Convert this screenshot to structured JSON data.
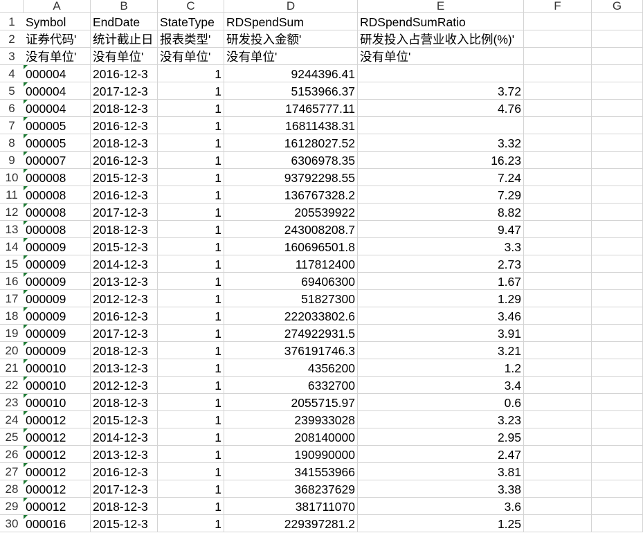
{
  "columns": [
    "A",
    "B",
    "C",
    "D",
    "E",
    "F",
    "G"
  ],
  "rows": [
    {
      "n": "1",
      "cells": [
        "Symbol",
        "EndDate",
        "StateType",
        "RDSpendSum",
        "RDSpendSumRatio",
        "",
        ""
      ]
    },
    {
      "n": "2",
      "cells": [
        "证券代码'",
        "统计截止日",
        "报表类型'",
        "研发投入金额'",
        "研发投入占营业收入比例(%)'",
        "",
        ""
      ]
    },
    {
      "n": "3",
      "cells": [
        "没有单位'",
        "没有单位'",
        "没有单位'",
        "没有单位'",
        "没有单位'",
        "",
        ""
      ]
    },
    {
      "n": "4",
      "cells": [
        "000004",
        "2016-12-3",
        "1",
        "9244396.41",
        "",
        "",
        ""
      ]
    },
    {
      "n": "5",
      "cells": [
        "000004",
        "2017-12-3",
        "1",
        "5153966.37",
        "3.72",
        "",
        ""
      ]
    },
    {
      "n": "6",
      "cells": [
        "000004",
        "2018-12-3",
        "1",
        "17465777.11",
        "4.76",
        "",
        ""
      ]
    },
    {
      "n": "7",
      "cells": [
        "000005",
        "2016-12-3",
        "1",
        "16811438.31",
        "",
        "",
        ""
      ]
    },
    {
      "n": "8",
      "cells": [
        "000005",
        "2018-12-3",
        "1",
        "16128027.52",
        "3.32",
        "",
        ""
      ]
    },
    {
      "n": "9",
      "cells": [
        "000007",
        "2016-12-3",
        "1",
        "6306978.35",
        "16.23",
        "",
        ""
      ]
    },
    {
      "n": "10",
      "cells": [
        "000008",
        "2015-12-3",
        "1",
        "93792298.55",
        "7.24",
        "",
        ""
      ]
    },
    {
      "n": "11",
      "cells": [
        "000008",
        "2016-12-3",
        "1",
        "136767328.2",
        "7.29",
        "",
        ""
      ]
    },
    {
      "n": "12",
      "cells": [
        "000008",
        "2017-12-3",
        "1",
        "205539922",
        "8.82",
        "",
        ""
      ]
    },
    {
      "n": "13",
      "cells": [
        "000008",
        "2018-12-3",
        "1",
        "243008208.7",
        "9.47",
        "",
        ""
      ]
    },
    {
      "n": "14",
      "cells": [
        "000009",
        "2015-12-3",
        "1",
        "160696501.8",
        "3.3",
        "",
        ""
      ]
    },
    {
      "n": "15",
      "cells": [
        "000009",
        "2014-12-3",
        "1",
        "117812400",
        "2.73",
        "",
        ""
      ]
    },
    {
      "n": "16",
      "cells": [
        "000009",
        "2013-12-3",
        "1",
        "69406300",
        "1.67",
        "",
        ""
      ]
    },
    {
      "n": "17",
      "cells": [
        "000009",
        "2012-12-3",
        "1",
        "51827300",
        "1.29",
        "",
        ""
      ]
    },
    {
      "n": "18",
      "cells": [
        "000009",
        "2016-12-3",
        "1",
        "222033802.6",
        "3.46",
        "",
        ""
      ]
    },
    {
      "n": "19",
      "cells": [
        "000009",
        "2017-12-3",
        "1",
        "274922931.5",
        "3.91",
        "",
        ""
      ]
    },
    {
      "n": "20",
      "cells": [
        "000009",
        "2018-12-3",
        "1",
        "376191746.3",
        "3.21",
        "",
        ""
      ]
    },
    {
      "n": "21",
      "cells": [
        "000010",
        "2013-12-3",
        "1",
        "4356200",
        "1.2",
        "",
        ""
      ]
    },
    {
      "n": "22",
      "cells": [
        "000010",
        "2012-12-3",
        "1",
        "6332700",
        "3.4",
        "",
        ""
      ]
    },
    {
      "n": "23",
      "cells": [
        "000010",
        "2018-12-3",
        "1",
        "2055715.97",
        "0.6",
        "",
        ""
      ]
    },
    {
      "n": "24",
      "cells": [
        "000012",
        "2015-12-3",
        "1",
        "239933028",
        "3.23",
        "",
        ""
      ]
    },
    {
      "n": "25",
      "cells": [
        "000012",
        "2014-12-3",
        "1",
        "208140000",
        "2.95",
        "",
        ""
      ]
    },
    {
      "n": "26",
      "cells": [
        "000012",
        "2013-12-3",
        "1",
        "190990000",
        "2.47",
        "",
        ""
      ]
    },
    {
      "n": "27",
      "cells": [
        "000012",
        "2016-12-3",
        "1",
        "341553966",
        "3.81",
        "",
        ""
      ]
    },
    {
      "n": "28",
      "cells": [
        "000012",
        "2017-12-3",
        "1",
        "368237629",
        "3.38",
        "",
        ""
      ]
    },
    {
      "n": "29",
      "cells": [
        "000012",
        "2018-12-3",
        "1",
        "381711070",
        "3.6",
        "",
        ""
      ]
    },
    {
      "n": "30",
      "cells": [
        "000016",
        "2015-12-3",
        "1",
        "229397281.2",
        "1.25",
        "",
        ""
      ]
    }
  ],
  "colors": {
    "gridline": "#d4d4d4",
    "text_indicator": "#1e7b34"
  }
}
